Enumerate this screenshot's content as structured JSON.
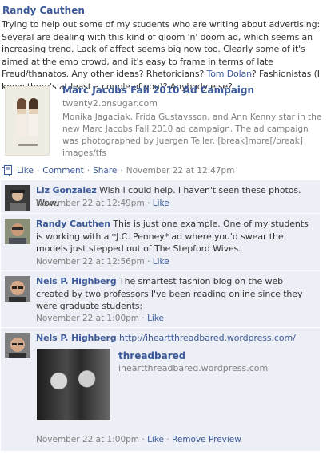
{
  "post": {
    "author": "Randy Cauthen",
    "text_part1": "Trying to help out some of my students who are writing about advertising: Several are dealing with this kind of gloom 'n' doom ad, which seems an increasing trend. Lack of affect seems big now too. Clearly some of it's aimed at the emo crowd, and it's easy to frame in terms of late Freud/thanatos. Any other ideas? Rhetoricians? ",
    "mention": "Tom Dolan",
    "text_part2": "? Fashionistas (I know there's at least a couple of you)? Anybody else?",
    "attachment": {
      "title": "Marc Jacobs Fall 2010 Ad Campaign",
      "url": "twenty2.onsugar.com",
      "description": "Monika Jagaciak, Frida Gustavsson, and Ann Kenny star in the new Marc Jacobs Fall 2010 ad campaign. The ad campaign was photographed by Juergen Teller. [break]more[/break] images/tfs"
    },
    "actions": {
      "like": "Like",
      "comment": "Comment",
      "share": "Share",
      "timestamp": "November 22 at 12:47pm",
      "separator": "·"
    }
  },
  "comments": [
    {
      "author": "Liz Gonzalez",
      "text": "Wish I could help. I haven't seen these photos. Wow.",
      "timestamp": "November 22 at 12:49pm",
      "like": "Like"
    },
    {
      "author": "Randy Cauthen",
      "text": "This is just one example. One of my students is working with a *J.C. Penney* ad where you'd swear the models just stepped out of The Stepford Wives.",
      "timestamp": "November 22 at 12:56pm",
      "like": "Like"
    },
    {
      "author": "Nels P. Highberg",
      "text": "The smartest fashion blog on the web created by two professors I've been reading online since they were graduate students:",
      "timestamp": "November 22 at 1:00pm",
      "like": "Like"
    },
    {
      "author": "Nels P. Highberg",
      "text": "http://iheartthreadbared.wordpress.com/",
      "timestamp": "November 22 at 1:00pm",
      "like": "Like",
      "remove_preview": "Remove Preview",
      "preview": {
        "title": "threadbared",
        "url": "iheartthreadbared.wordpress.com"
      }
    }
  ],
  "colors": {
    "link": "#3b5998",
    "meta": "#808080",
    "comment_bg": "#eceff5"
  }
}
